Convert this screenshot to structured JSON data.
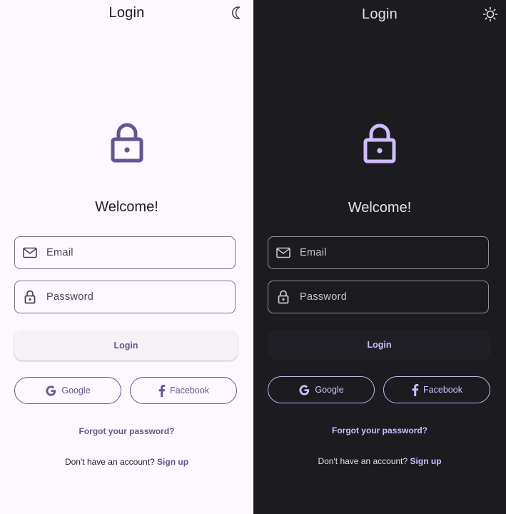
{
  "colors": {
    "light_bg": "#fdf7ff",
    "dark_bg": "#1c1b1f",
    "light_primary": "#65558f",
    "dark_primary": "#cfbcff"
  },
  "light": {
    "title": "Login",
    "theme_toggle_icon": "moon-icon",
    "welcome": "Welcome!",
    "email_placeholder": "Email",
    "password_placeholder": "Password",
    "login_label": "Login",
    "google_label": "Google",
    "facebook_label": "Facebook",
    "forgot_label": "Forgot your password?",
    "no_account_text": "Don't have an account?",
    "signup_label": "Sign up"
  },
  "dark": {
    "title": "Login",
    "theme_toggle_icon": "sun-icon",
    "welcome": "Welcome!",
    "email_placeholder": "Email",
    "password_placeholder": "Password",
    "login_label": "Login",
    "google_label": "Google",
    "facebook_label": "Facebook",
    "forgot_label": "Forgot your password?",
    "no_account_text": "Don't have an account?",
    "signup_label": "Sign up"
  }
}
